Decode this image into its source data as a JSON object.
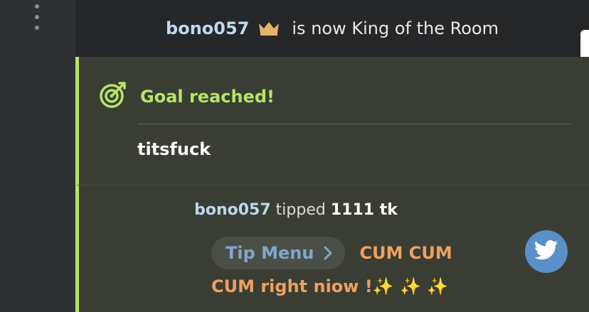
{
  "king_announcement": {
    "username": "bono057",
    "message": "is now King of the Room",
    "icon": "crown-icon"
  },
  "goal": {
    "title": "Goal reached!",
    "name": "titsfuck",
    "icon": "target-icon",
    "accent": "#b7e466"
  },
  "tip": {
    "username": "bono057",
    "action": "tipped",
    "amount": "1111 tk",
    "menu_button": "Tip Menu",
    "menu_item_line1": "CUM CUM",
    "menu_item_line2": "CUM right niow !✨ ✨ ✨"
  },
  "share": {
    "icon": "twitter-icon",
    "color": "#5b8fc8"
  }
}
